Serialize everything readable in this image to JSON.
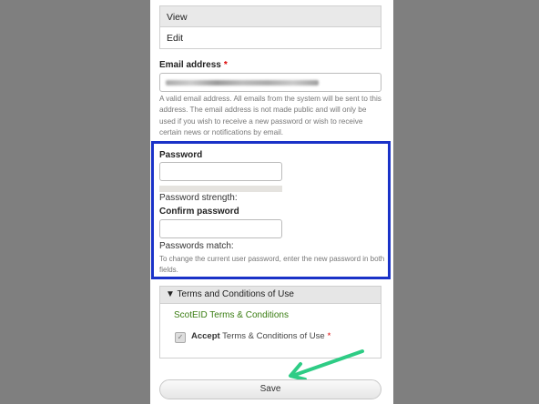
{
  "tabs": [
    {
      "label": "View"
    },
    {
      "label": "Edit"
    }
  ],
  "email": {
    "label": "Email address",
    "required_mark": "*",
    "description": "A valid email address. All emails from the system will be sent to this address. The email address is not made public and will only be used if you wish to receive a new password or wish to receive certain news or notifications by email."
  },
  "password": {
    "label": "Password",
    "value": "",
    "strength_label": "Password strength:"
  },
  "confirm_password": {
    "label": "Confirm password",
    "value": "",
    "match_label": "Passwords match:",
    "description": "To change the current user password, enter the new password in both fields."
  },
  "terms": {
    "header": "Terms and Conditions of Use",
    "toggle": "▼",
    "link": "ScotEID Terms & Conditions",
    "accept_bold": "Accept",
    "accept_rest": "Terms & Conditions of Use",
    "required_mark": "*",
    "checked": true
  },
  "actions": {
    "save_label": "Save"
  },
  "colors": {
    "highlight_box": "#1a32c8",
    "annotation_arrow": "#2ecc85",
    "link": "#3a7d12"
  }
}
